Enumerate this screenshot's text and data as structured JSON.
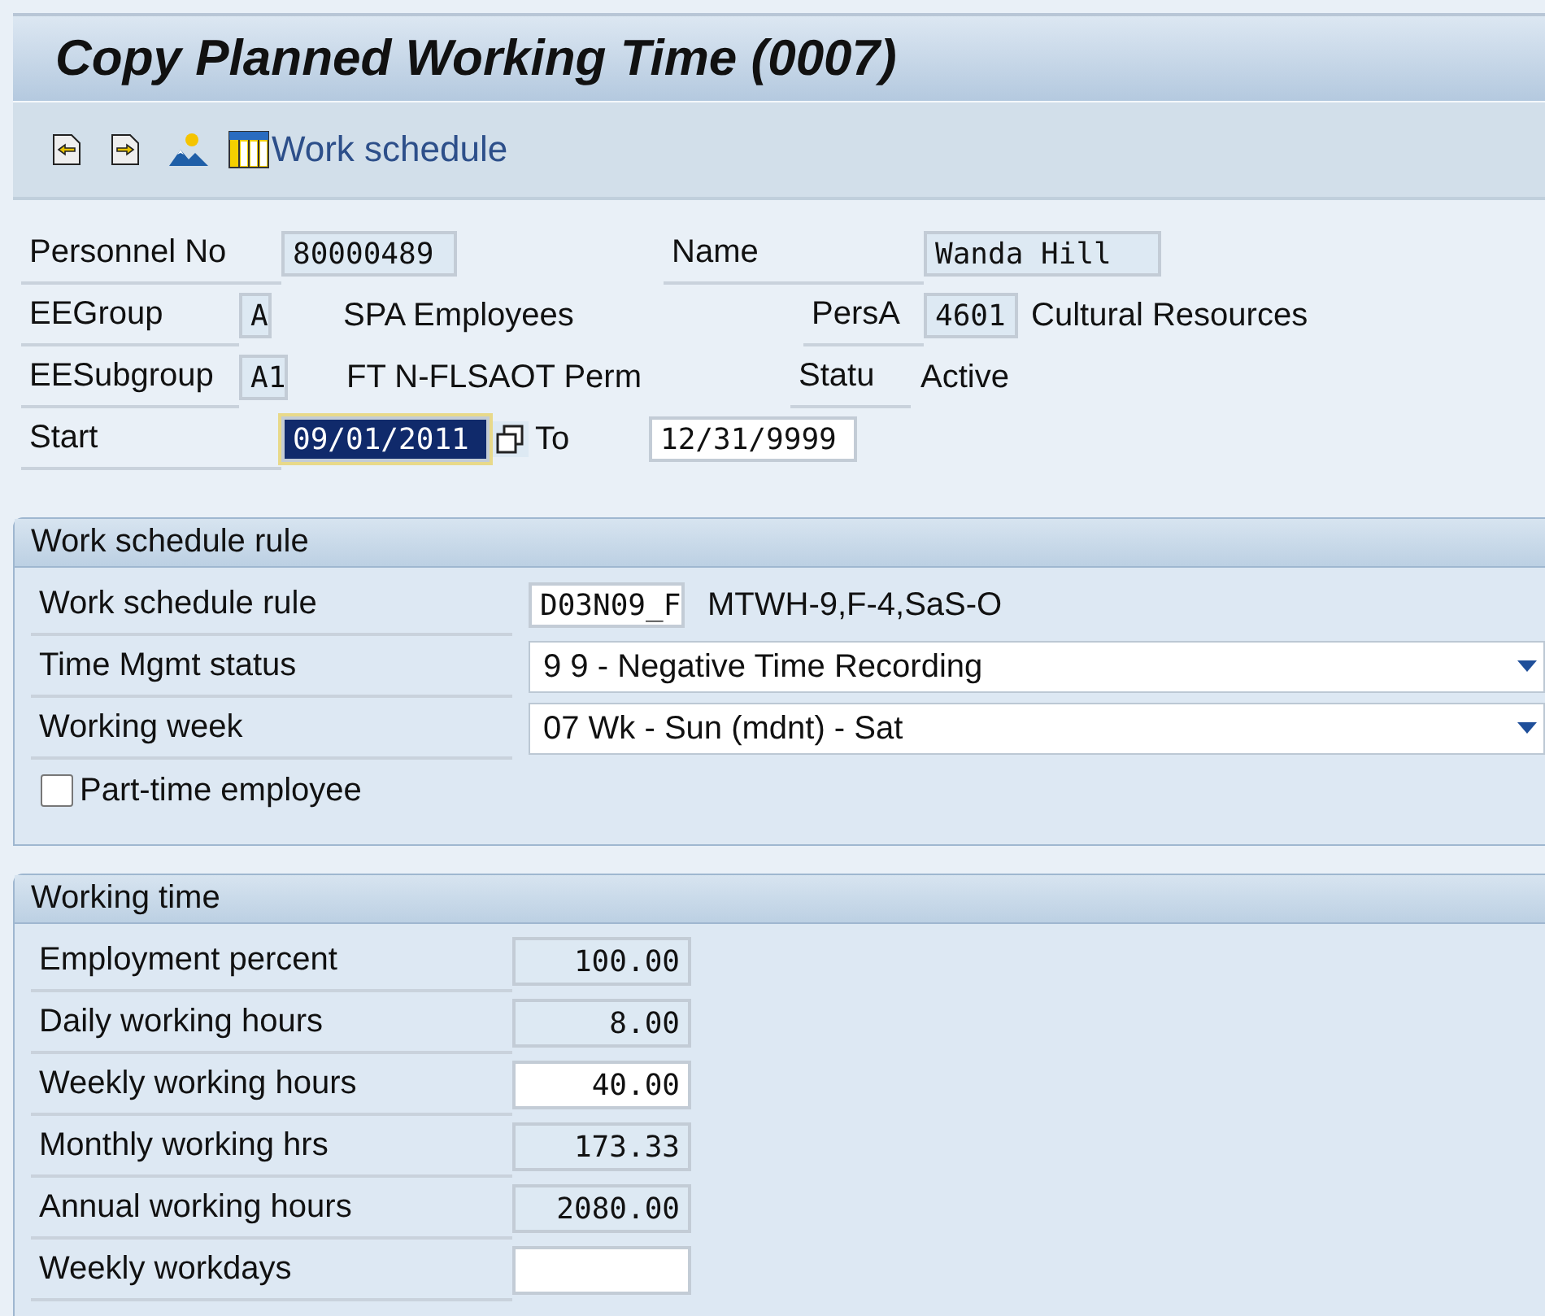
{
  "window": {
    "title": "Copy Planned Working Time (0007)"
  },
  "toolbar": {
    "schedule_button": "Work schedule"
  },
  "header": {
    "personnel_no": {
      "label": "Personnel No",
      "field": {
        "value": "80000489",
        "editable": false
      }
    },
    "name": {
      "label": "Name",
      "field": {
        "value": "Wanda Hill",
        "editable": false
      }
    },
    "ee_group": {
      "label": "EEGroup",
      "field": {
        "value": "A",
        "editable": false
      },
      "text": "SPA Employees"
    },
    "pers_area": {
      "label": "PersA",
      "field": {
        "value": "4601",
        "editable": false
      },
      "text": "Cultural Resources"
    },
    "ee_subgroup": {
      "label": "EESubgroup",
      "field": {
        "value": "A1",
        "editable": false
      },
      "text": "FT N-FLSAOT Perm"
    },
    "status": {
      "label": "Statu",
      "text": "Active"
    },
    "start": {
      "label": "Start",
      "field": {
        "value": "09/01/2011",
        "selected": true
      }
    },
    "to": {
      "label": "To",
      "field": {
        "value": "12/31/9999",
        "editable": true,
        "selected": false
      }
    }
  },
  "sections": [
    {
      "title": "Work schedule rule",
      "rows": [
        {
          "kind": "code",
          "label": "Work schedule rule",
          "value": "D03N09_F",
          "text": "MTWH-9,F-4,SaS-O"
        },
        {
          "kind": "dropdown",
          "label": "Time Mgmt status",
          "value": "9 9 - Negative Time Recording"
        },
        {
          "kind": "dropdown",
          "label": "Working week",
          "value": "07 Wk - Sun (mdnt) - Sat"
        },
        {
          "kind": "checkbox",
          "label": "Part-time employee",
          "checked": false
        }
      ]
    },
    {
      "title": "Working time",
      "rows": [
        {
          "kind": "number",
          "label": "Employment percent",
          "value": "100.00",
          "editable": false
        },
        {
          "kind": "number",
          "label": "Daily working hours",
          "value": "8.00",
          "editable": false
        },
        {
          "kind": "number",
          "label": "Weekly working hours",
          "value": "40.00",
          "editable": true
        },
        {
          "kind": "number",
          "label": "Monthly working hrs",
          "value": "173.33",
          "editable": false
        },
        {
          "kind": "number",
          "label": "Annual working hours",
          "value": "2080.00",
          "editable": false
        },
        {
          "kind": "number",
          "label": "Weekly workdays",
          "editable": true
        }
      ]
    }
  ]
}
